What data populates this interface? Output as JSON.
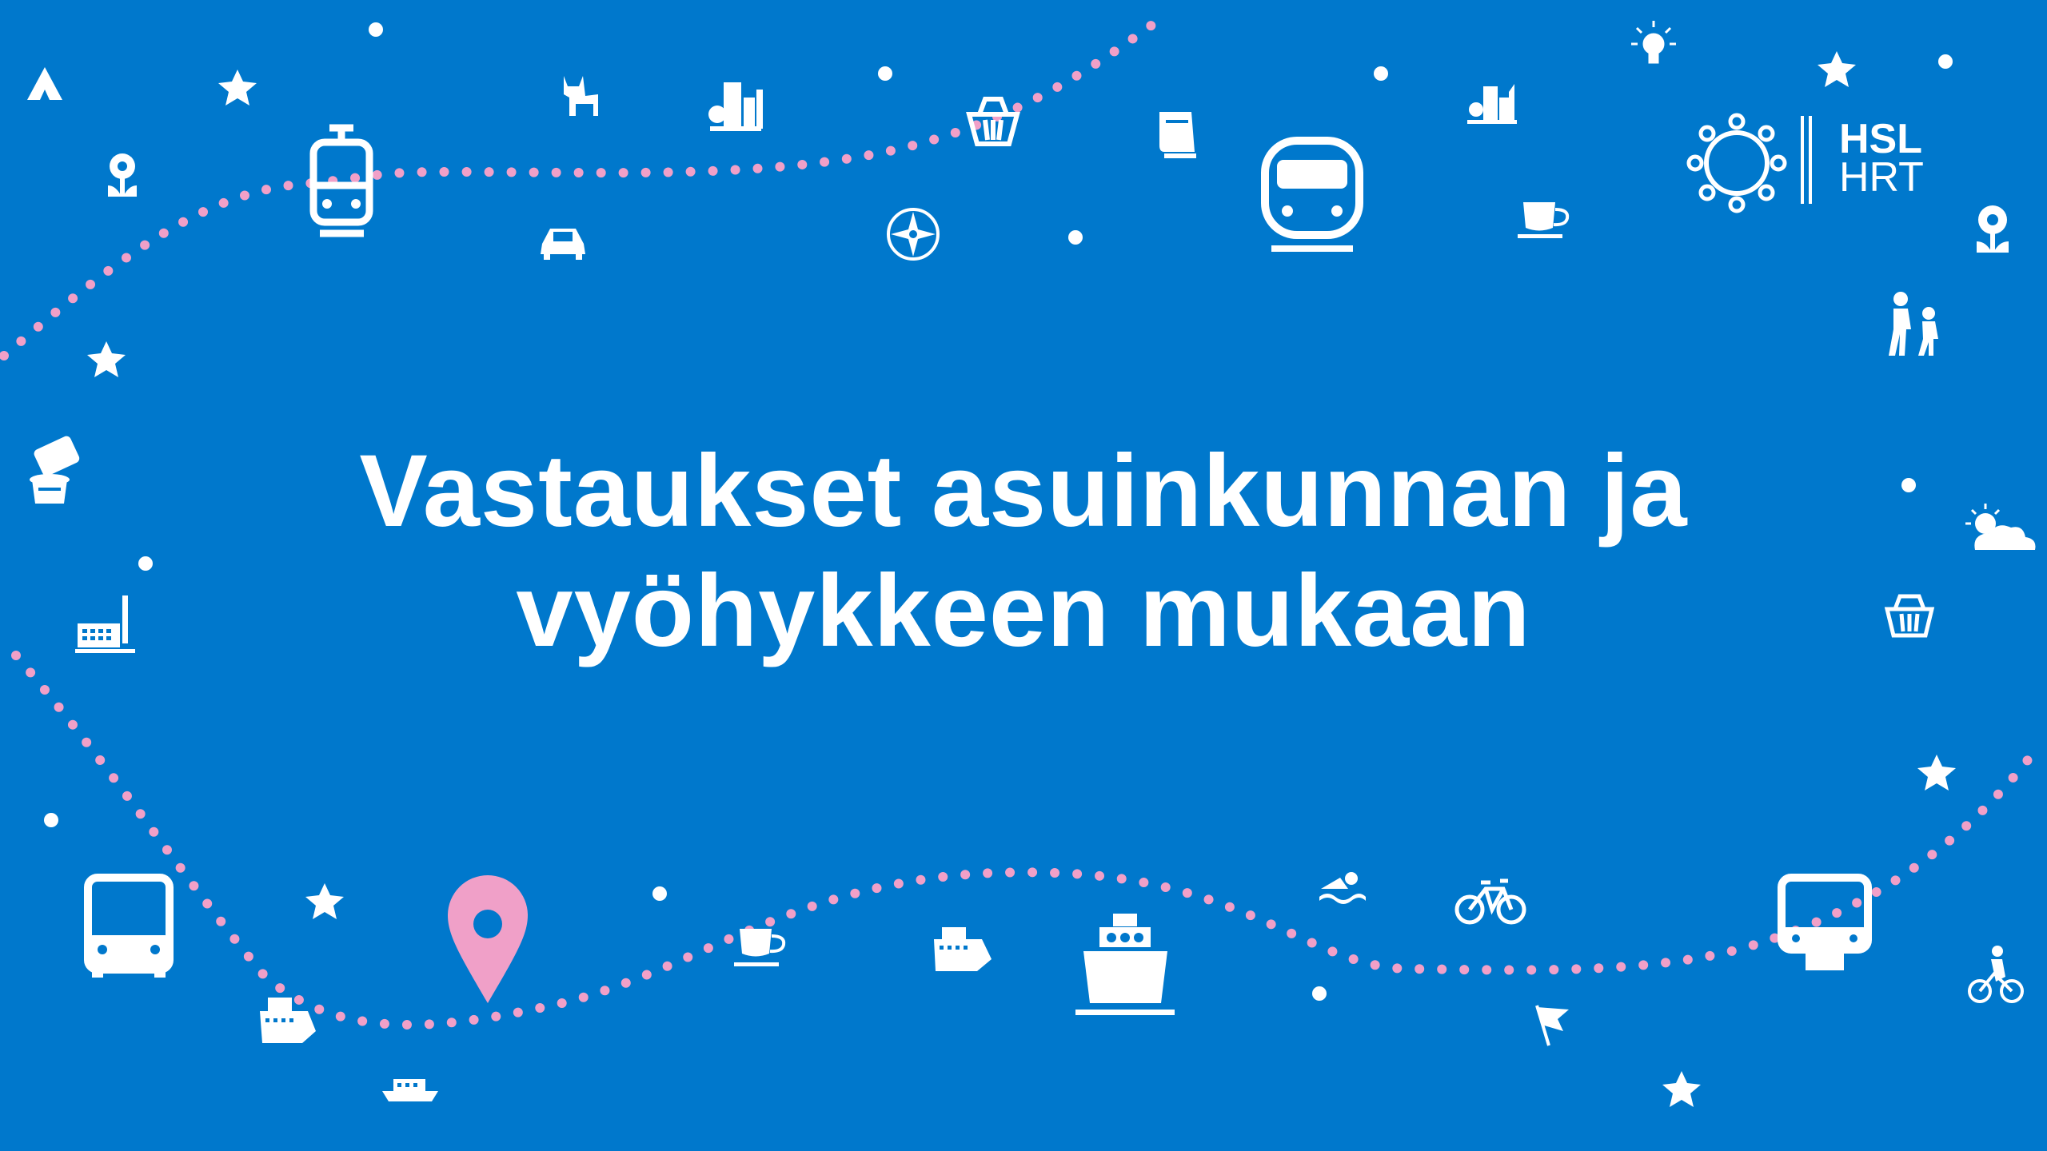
{
  "slide": {
    "title_line1": "Vastaukset asuinkunnan ja",
    "title_line2": "vyöhykkeen mukaan"
  },
  "logo": {
    "line1": "HSL",
    "line2": "HRT"
  },
  "colors": {
    "background": "#0078cc",
    "route_dots": "#f1a0c8",
    "icons": "#ffffff",
    "location_pin": "#f0a0c8"
  },
  "icons": [
    "tent-icon",
    "star-icon",
    "cat-icon",
    "city-buildings-icon",
    "shopping-basket-icon",
    "lightbulb-icon",
    "tram-icon",
    "flower-icon",
    "car-icon",
    "compass-icon",
    "book-icon",
    "train-icon",
    "coffee-cup-icon",
    "walking-people-icon",
    "hand-ballot-icon",
    "weather-icon",
    "factory-icon",
    "bus-icon",
    "location-pin-icon",
    "ferry-icon",
    "ship-icon",
    "swimmer-icon",
    "bicycle-icon",
    "cyclist-icon",
    "flag-icon",
    "boat-icon",
    "metro-icon"
  ]
}
